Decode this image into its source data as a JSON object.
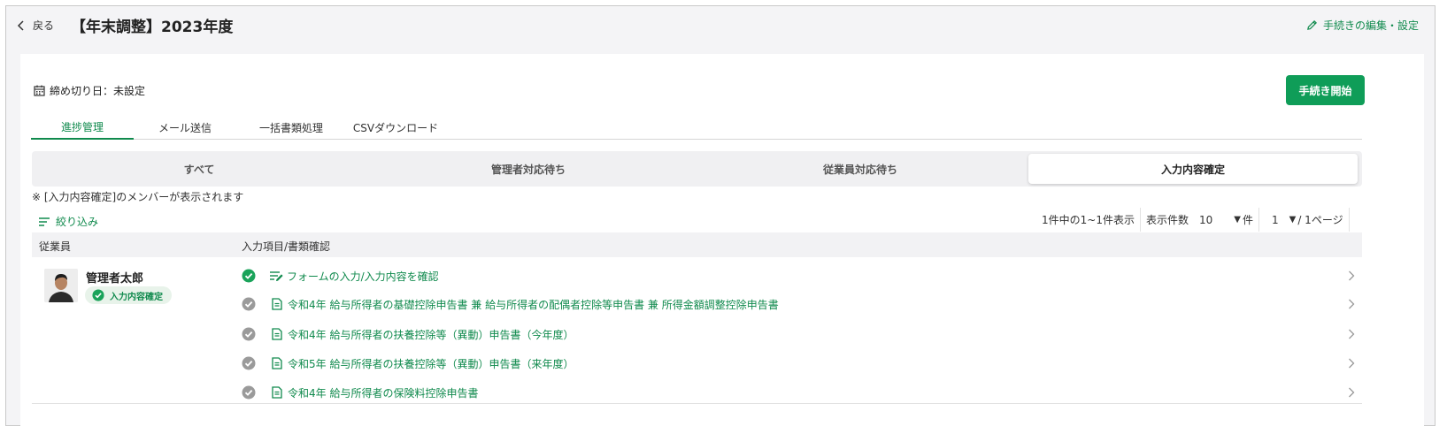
{
  "header": {
    "back_label": "戻る",
    "title": "【年末調整】2023年度",
    "edit_label": "手続きの編集・設定"
  },
  "deadline": {
    "label": "締め切り日：未設定"
  },
  "start_button": {
    "label": "手続き開始"
  },
  "tabs": [
    {
      "label": "進捗管理",
      "active": true
    },
    {
      "label": "メール送信",
      "active": false
    },
    {
      "label": "一括書類処理",
      "active": false
    },
    {
      "label": "CSVダウンロード",
      "active": false
    }
  ],
  "segments": [
    {
      "label": "すべて",
      "active": false
    },
    {
      "label": "管理者対応待ち",
      "active": false
    },
    {
      "label": "従業員対応待ち",
      "active": false
    },
    {
      "label": "入力内容確定",
      "active": true
    }
  ],
  "note": "※ [入力内容確定]のメンバーが表示されます",
  "filter": {
    "label": "絞り込み"
  },
  "pager": {
    "summary": "1件中の1~1件表示",
    "per_page_label": "表示件数",
    "per_page_value": "10",
    "per_page_unit": "件",
    "page_value": "1",
    "page_total": "/ 1ページ"
  },
  "table": {
    "headers": {
      "employee": "従業員",
      "items": "入力項目/書類確認"
    },
    "row": {
      "employee_name": "管理者太郎",
      "status_badge": "入力内容確定",
      "items": [
        {
          "type": "form",
          "done": true,
          "label": "フォームの入力/入力内容を確認"
        },
        {
          "type": "document",
          "done": false,
          "label": "令和4年 給与所得者の基礎控除申告書 兼 給与所得者の配偶者控除等申告書 兼 所得金額調整控除申告書"
        },
        {
          "type": "document",
          "done": false,
          "label": "令和4年 給与所得者の扶養控除等（異動）申告書（今年度）"
        },
        {
          "type": "document",
          "done": false,
          "label": "令和5年 給与所得者の扶養控除等（異動）申告書（来年度）"
        },
        {
          "type": "document",
          "done": false,
          "label": "令和4年 給与所得者の保険料控除申告書"
        }
      ]
    }
  },
  "colors": {
    "accent": "#108a4d",
    "primary_button": "#0f9d58",
    "done_icon": "#1aa35a",
    "pending_icon": "#9a9a9a"
  }
}
